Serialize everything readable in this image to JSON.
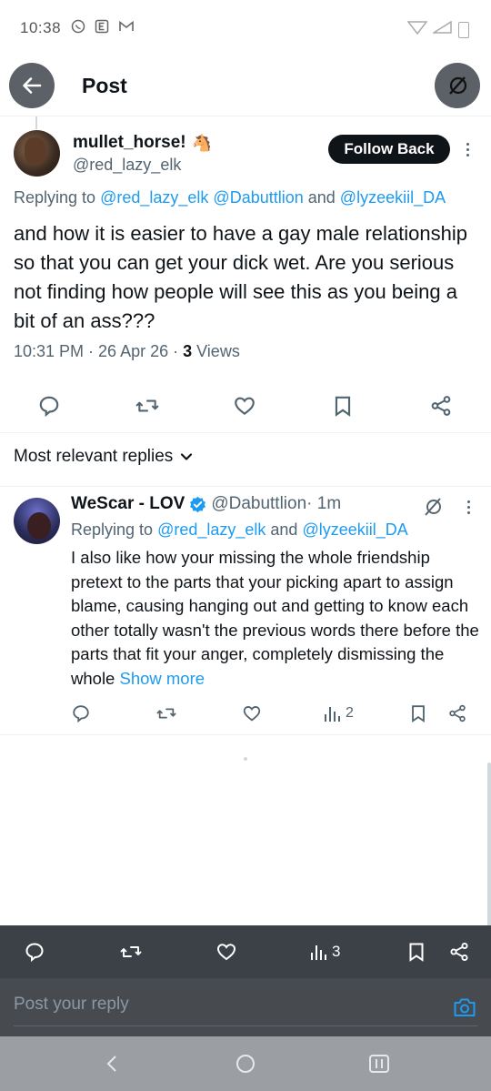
{
  "status_bar": {
    "time": "10:38",
    "left_icons": [
      "whatsapp-icon",
      "e-icon",
      "gmail-icon"
    ]
  },
  "header": {
    "title": "Post"
  },
  "post": {
    "author_name": "mullet_horse!",
    "author_emoji": "🐴",
    "author_handle": "@red_lazy_elk",
    "follow_label": "Follow Back",
    "replying_prefix": "Replying to ",
    "replying_1": "@red_lazy_elk",
    "replying_2": "@Dabuttlion",
    "replying_and": " and ",
    "replying_3": "@lyzeekiil_DA",
    "text": "and how it is easier to have a gay male relationship so that you can get your dick wet. Are you serious not finding how people will see this as you being a bit of an ass???",
    "time": "10:31 PM · 26 Apr 26 · ",
    "views_count": "3",
    "views_label": " Views"
  },
  "sort": {
    "label": "Most relevant replies"
  },
  "reply": {
    "author_name": "WeScar - LOV",
    "author_handle": "@Dabuttlion",
    "time": " · 1m",
    "replying_prefix": "Replying to ",
    "replying_1": "@red_lazy_elk",
    "replying_and": " and ",
    "replying_2": "@lyzeekiil_DA",
    "text": "I also like how your missing the whole friendship pretext to the parts that your picking apart to assign blame, causing hanging out and getting to know each other totally wasn't the previous words there before the parts that fit your anger, completely dismissing the whole ",
    "show_more": "Show more",
    "views": "2"
  },
  "bottom_bar": {
    "views": "3"
  },
  "reply_box": {
    "placeholder": "Post your reply"
  },
  "colors": {
    "accent": "#1d9bf0",
    "text": "#0f1419",
    "muted": "#536471",
    "bottom_bar": "#3c4147"
  }
}
